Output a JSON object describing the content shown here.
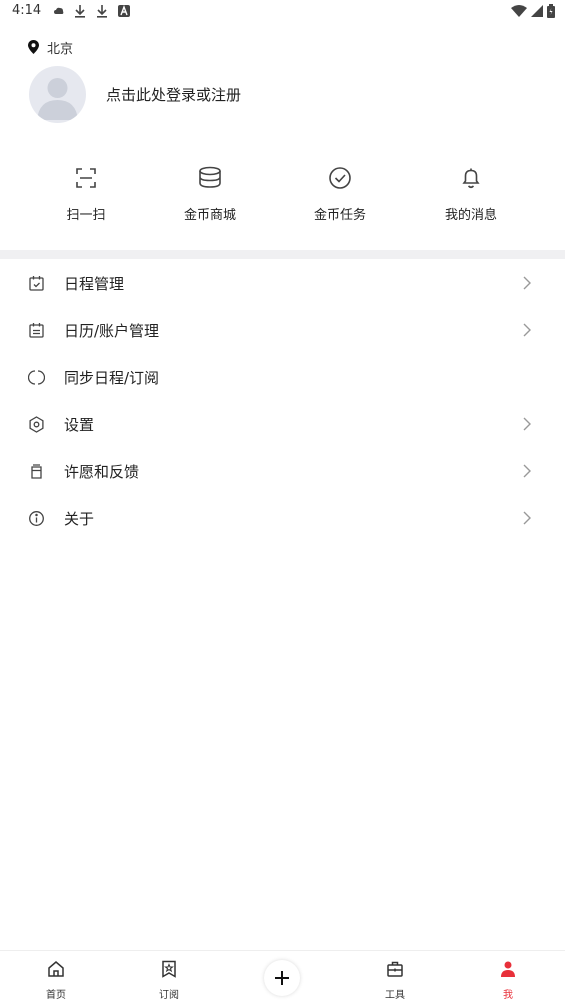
{
  "status_bar": {
    "time": "4:14",
    "left_icons": [
      "cloud-icon",
      "download-icon",
      "download-icon",
      "a-badge-icon"
    ],
    "right_icons": [
      "wifi-icon",
      "signal-icon",
      "battery-icon"
    ]
  },
  "location": {
    "icon": "location-pin-icon",
    "text": "北京"
  },
  "profile": {
    "login_prompt": "点击此处登录或注册"
  },
  "quick_actions": [
    {
      "icon": "scan-icon",
      "label": "扫一扫"
    },
    {
      "icon": "coin-stack-icon",
      "label": "金币商城"
    },
    {
      "icon": "check-circle-icon",
      "label": "金币任务"
    },
    {
      "icon": "bell-icon",
      "label": "我的消息"
    }
  ],
  "menu": [
    {
      "icon": "calendar-check-icon",
      "label": "日程管理",
      "chevron": true
    },
    {
      "icon": "calendar-list-icon",
      "label": "日历/账户管理",
      "chevron": true
    },
    {
      "icon": "sync-icon",
      "label": "同步日程/订阅",
      "chevron": false
    },
    {
      "icon": "gear-icon",
      "label": "设置",
      "chevron": true
    },
    {
      "icon": "cup-icon",
      "label": "许愿和反馈",
      "chevron": true
    },
    {
      "icon": "info-icon",
      "label": "关于",
      "chevron": true
    }
  ],
  "tab_bar": {
    "tabs": [
      {
        "icon": "home-icon",
        "label": "首页",
        "active": false
      },
      {
        "icon": "bookmark-star-icon",
        "label": "订阅",
        "active": false
      },
      {
        "icon": "toolbox-icon",
        "label": "工具",
        "active": false
      },
      {
        "icon": "person-icon",
        "label": "我",
        "active": true
      }
    ],
    "add_icon": "plus-icon"
  },
  "colors": {
    "accent": "#e8303a",
    "divider": "#f0f0f2",
    "avatar_bg": "#e6e8ef"
  }
}
